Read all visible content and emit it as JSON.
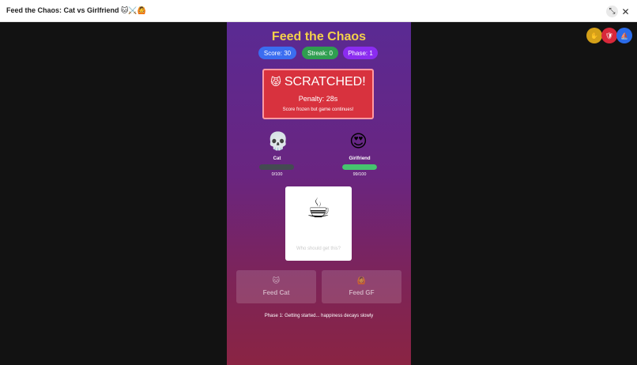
{
  "window": {
    "title": "Feed the Chaos: Cat vs Girlfriend 🐱⚔️🙆"
  },
  "game": {
    "title": "Feed the Chaos",
    "stats": {
      "score": "Score: 30",
      "streak": "Streak: 0",
      "phase": "Phase: 1"
    },
    "alert": {
      "emoji": "😾",
      "heading": "SCRATCHED!",
      "penalty": "Penalty: 28s",
      "note": "Score frozen but game continues!"
    },
    "characters": [
      {
        "name": "Cat",
        "emoji": "💀",
        "happiness": "0/100",
        "happiness_value": 0
      },
      {
        "name": "Girlfriend",
        "emoji": "😍",
        "happiness": "99/100",
        "happiness_value": 99
      }
    ],
    "item": {
      "emoji": "☕",
      "prompt": "Who should get this?"
    },
    "buttons": {
      "feed_cat": {
        "icon": "🐱",
        "label": "Feed Cat"
      },
      "feed_gf": {
        "icon": "🙆",
        "label": "Feed GF"
      }
    },
    "phase_text": "Phase 1: Getting started... happiness decays slowly"
  },
  "floating_buttons": [
    {
      "icon": "✋",
      "color": "#d4a018"
    },
    {
      "icon": "🛡",
      "color": "#d8283a"
    },
    {
      "icon": "⛵",
      "color": "#2b6be8"
    }
  ],
  "colors": {
    "title_gold": "#f3d14a",
    "score_pill": "#3b6df0",
    "streak_pill": "#2f9e50",
    "phase_pill": "#8b2cf0",
    "alert_red": "#d8323e",
    "happiness_green": "#46c36f"
  }
}
